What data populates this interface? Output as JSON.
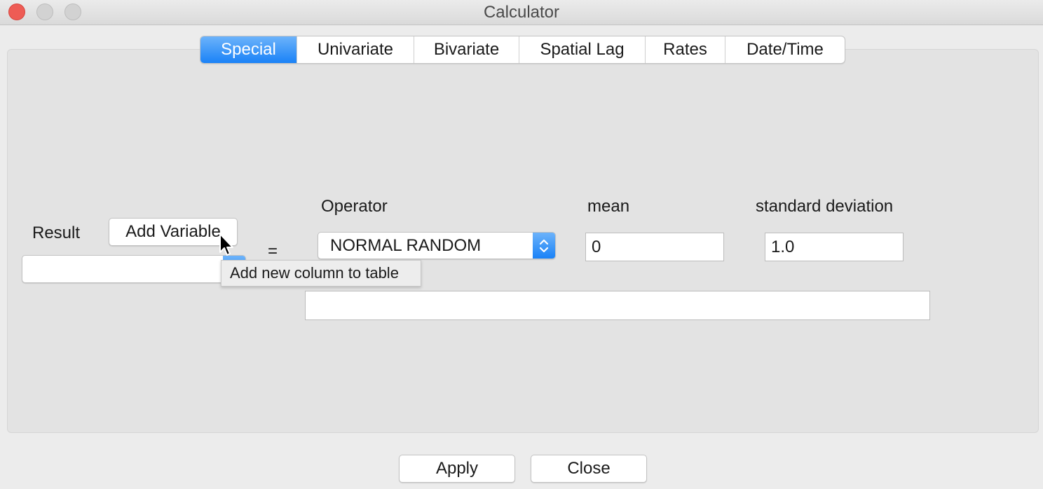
{
  "window": {
    "title": "Calculator"
  },
  "tabs": [
    {
      "label": "Special",
      "active": true
    },
    {
      "label": "Univariate",
      "active": false
    },
    {
      "label": "Bivariate",
      "active": false
    },
    {
      "label": "Spatial Lag",
      "active": false
    },
    {
      "label": "Rates",
      "active": false
    },
    {
      "label": "Date/Time",
      "active": false
    }
  ],
  "form": {
    "result_label": "Result",
    "add_variable_label": "Add Variable",
    "result_value": "",
    "equals": "=",
    "operator_label": "Operator",
    "operator_value": "NORMAL RANDOM",
    "mean_label": "mean",
    "mean_value": "0",
    "sd_label": "standard deviation",
    "sd_value": "1.0",
    "expression_value": ""
  },
  "tooltip": {
    "text": "Add new column to table"
  },
  "footer": {
    "apply_label": "Apply",
    "close_label": "Close"
  },
  "colors": {
    "accent": "#1a82f7",
    "close_light": "#ee5c55",
    "window_bg": "#ececec",
    "panel_bg": "#e3e3e3"
  }
}
